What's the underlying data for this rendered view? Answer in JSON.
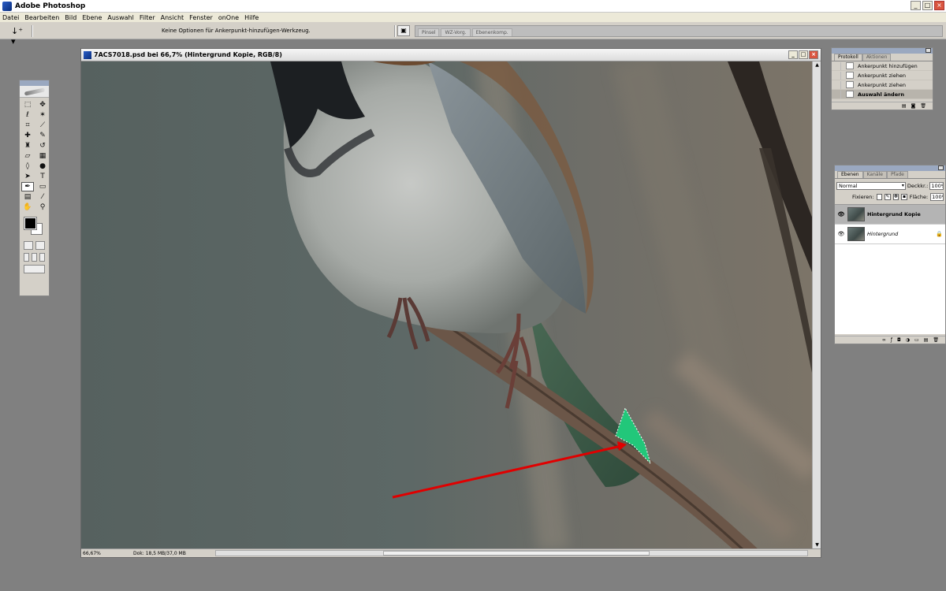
{
  "app": {
    "title": "Adobe Photoshop"
  },
  "menu": [
    "Datei",
    "Bearbeiten",
    "Bild",
    "Ebene",
    "Auswahl",
    "Filter",
    "Ansicht",
    "Fenster",
    "onOne",
    "Hilfe"
  ],
  "options": {
    "hint": "Keine Optionen für Ankerpunkt-hinzufügen-Werkzeug.",
    "tool_glyph": "↓⁺ ▾"
  },
  "palette_well": {
    "tabs": [
      "Pinsel",
      "WZ-Vorg.",
      "Ebenenkomp."
    ]
  },
  "document": {
    "title": "7ACS7018.psd bei 66,7% (Hintergrund Kopie, RGB/8)",
    "zoom": "66,67%",
    "doc_size": "Dok: 18,5 MB/37,0 MB"
  },
  "history": {
    "tabs": [
      "Protokoll",
      "Aktionen"
    ],
    "items": [
      "Ankerpunkt hinzufügen",
      "Ankerpunkt ziehen",
      "Ankerpunkt ziehen",
      "Auswahl ändern"
    ],
    "current_index": 3
  },
  "layers": {
    "tabs": [
      "Ebenen",
      "Kanäle",
      "Pfade"
    ],
    "blend_mode": "Normal",
    "opacity_label": "Deckkr.:",
    "opacity": "100%",
    "lock_label": "Fixieren:",
    "fill_label": "Fläche:",
    "fill": "100%",
    "items": [
      {
        "name": "Hintergrund Kopie"
      },
      {
        "name": "Hintergrund"
      }
    ]
  },
  "colors": {
    "canvas_bg": "#5f6a68",
    "annotation_arrow": "#e00000",
    "selection_fill": "#22c77a"
  }
}
